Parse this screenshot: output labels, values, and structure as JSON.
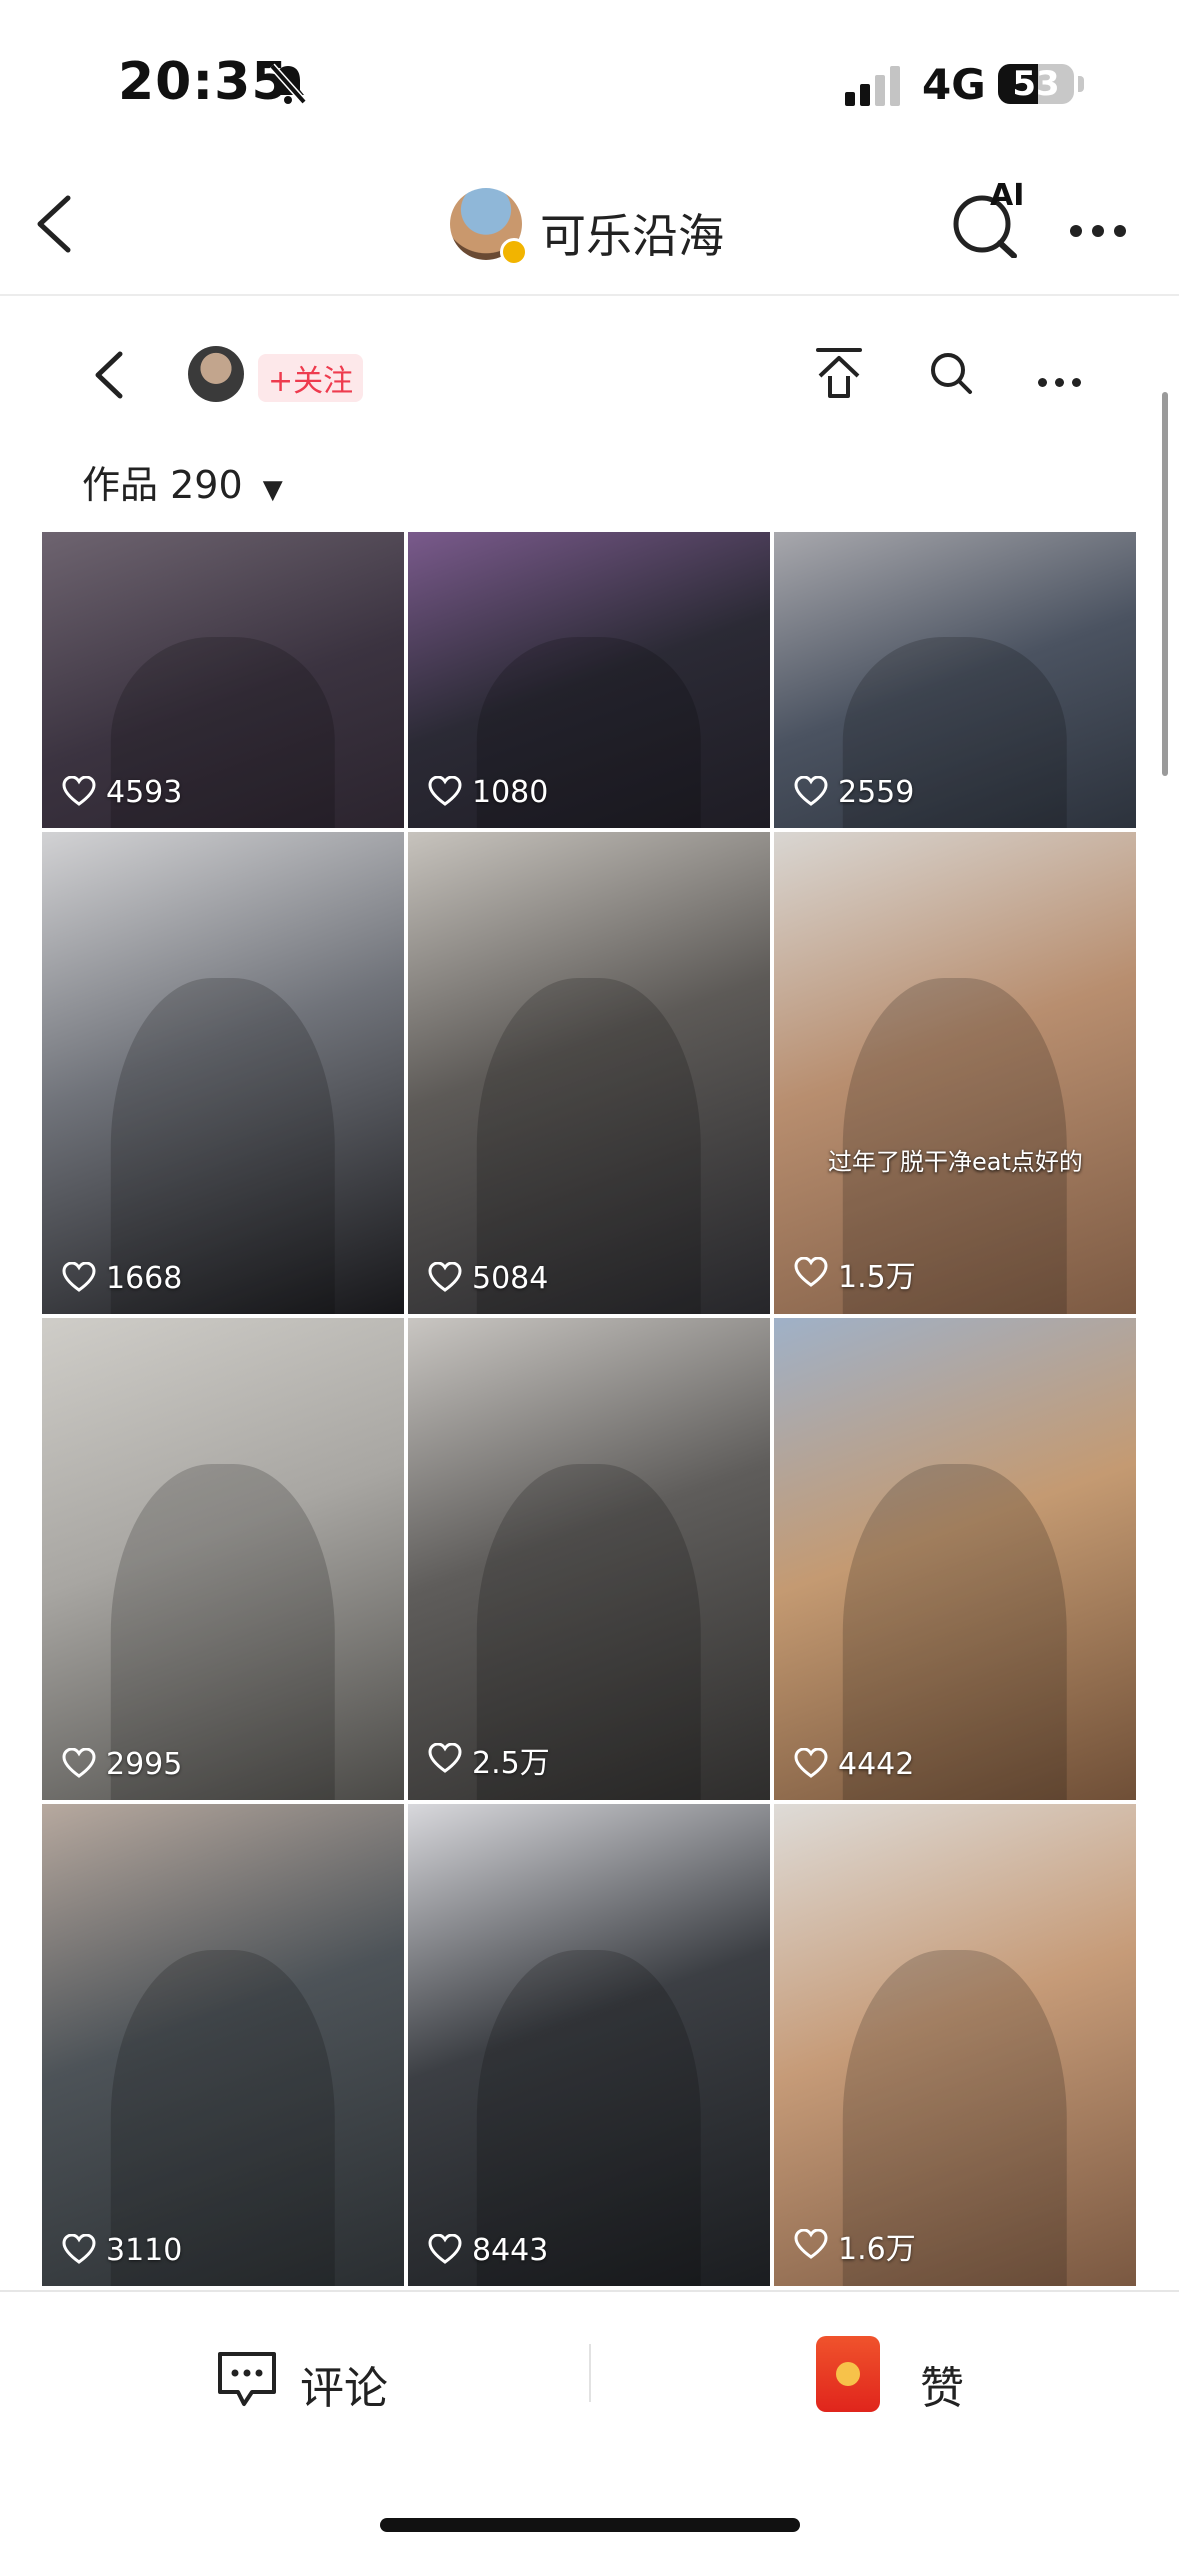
{
  "status_bar": {
    "time": "20:35",
    "network": "4G",
    "battery_level": "53",
    "battery_fraction": 0.53
  },
  "header": {
    "title": "可乐沿海",
    "ai_label": "AI"
  },
  "profile": {
    "follow_label": "+关注",
    "works_label": "作品",
    "works_count": "290",
    "works_arrow": "▼"
  },
  "videos": [
    {
      "likes": "4593",
      "bg": "linear-gradient(160deg,#6e6470,#3b3340 55%,#2b242e)"
    },
    {
      "likes": "1080",
      "bg": "linear-gradient(160deg,#7a5a8c,#2b2a35 50%,#1e1c24)"
    },
    {
      "likes": "2559",
      "bg": "linear-gradient(160deg,#a8a8ad,#4b5361 50%,#2c323c)"
    },
    {
      "likes": "1668",
      "bg": "linear-gradient(160deg,#d2d2d4,#70737a 45%,#17171a)"
    },
    {
      "likes": "5084",
      "bg": "linear-gradient(160deg,#c7c3bd,#5d5a57 45%,#26262a)"
    },
    {
      "likes": "1.5万",
      "bg": "linear-gradient(160deg,#d9d6d2,#b88e6f 45%,#7c5a43)",
      "caption": "过年了脱干净eat点好的"
    },
    {
      "likes": "2995",
      "bg": "linear-gradient(160deg,#cfcdc8,#a8a6a2 45%,#4a4946)"
    },
    {
      "likes": "2.5万",
      "bg": "linear-gradient(160deg,#c9c6c2,#5f5d5b 45%,#2e2d2c)"
    },
    {
      "likes": "4442",
      "bg": "linear-gradient(160deg,#9fb1c8,#c49a72 45%,#6f4f37)"
    },
    {
      "likes": "3110",
      "bg": "linear-gradient(160deg,#b7a99f,#4d5358 45%,#2a2e31)"
    },
    {
      "likes": "8443",
      "bg": "linear-gradient(160deg,#d8d8dc,#3c3f44 45%,#1b1d20)"
    },
    {
      "likes": "1.6万",
      "bg": "linear-gradient(160deg,#dedbd7,#c69b78 45%,#7a5841)"
    }
  ],
  "bottom_bar": {
    "comment_label": "评论",
    "like_label": "赞"
  }
}
